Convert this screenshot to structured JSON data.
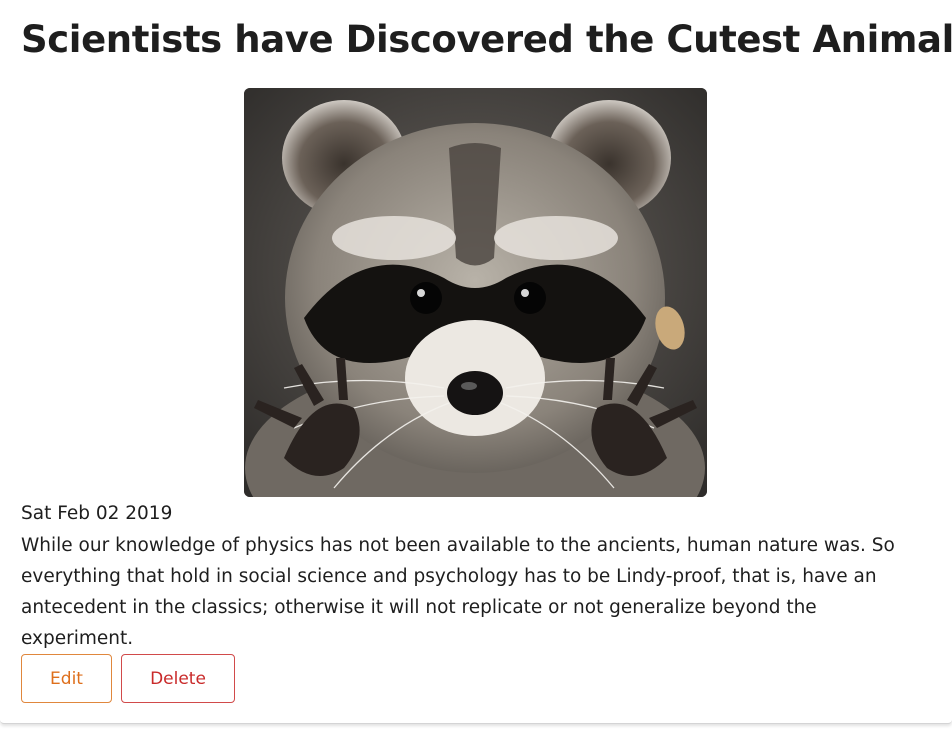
{
  "article": {
    "title": "Scientists have Discovered the Cutest Animal",
    "image_subject": "raccoon",
    "date": "Sat Feb 02 2019",
    "body": "While our knowledge of physics has not been available to the ancients, human nature was. So everything that hold in social science and psychology has to be Lindy-proof, that is, have an antecedent in the classics; otherwise it will not replicate or not generalize beyond the experiment."
  },
  "actions": {
    "edit_label": "Edit",
    "delete_label": "Delete"
  },
  "colors": {
    "edit": "#de6f1c",
    "delete": "#c92a2a"
  }
}
